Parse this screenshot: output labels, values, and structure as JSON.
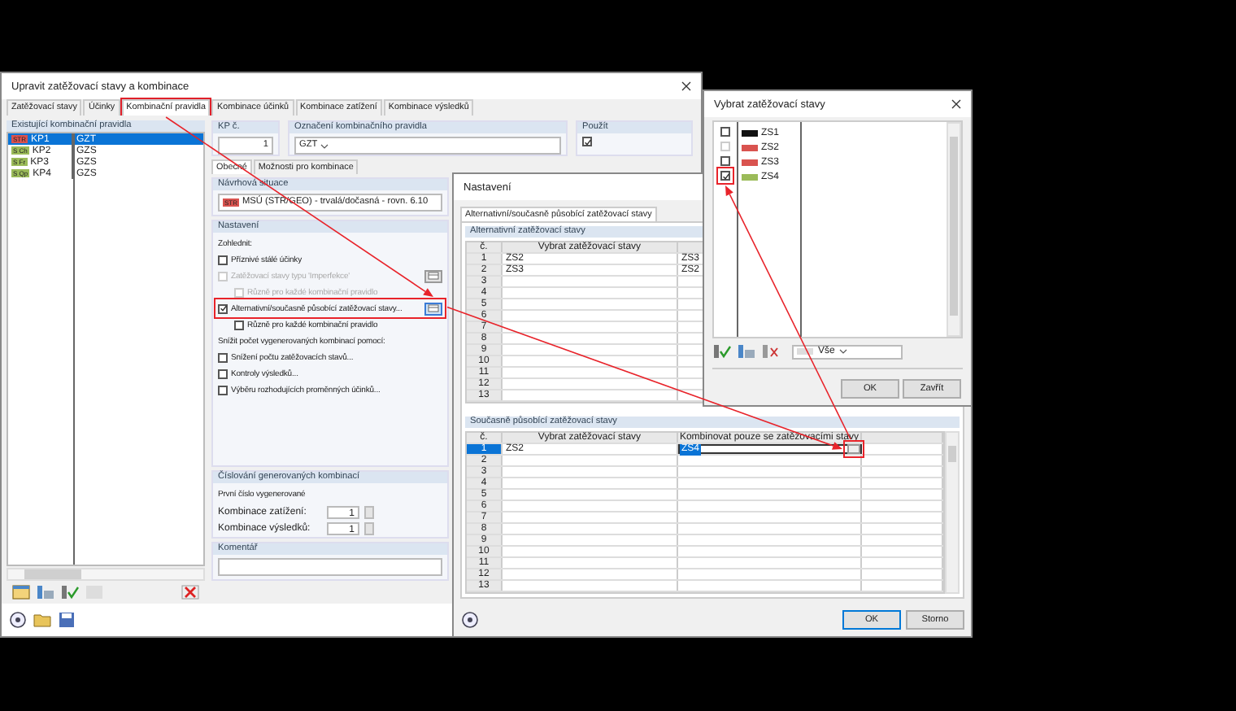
{
  "main_window": {
    "title": "Upravit zatěžovací stavy a kombinace",
    "tabs": [
      {
        "label": "Zatěžovací stavy",
        "selected": false
      },
      {
        "label": "Účinky",
        "selected": false
      },
      {
        "label": "Kombinační pravidla",
        "selected": true
      },
      {
        "label": "Kombinace účinků",
        "selected": false
      },
      {
        "label": "Kombinace zatížení",
        "selected": false
      },
      {
        "label": "Kombinace výsledků",
        "selected": false
      }
    ],
    "rules_list": {
      "header": "Existující kombinační pravidla",
      "rows": [
        {
          "tag": "STR",
          "color": "#d9534f",
          "id": "KP1",
          "value": "GZT",
          "selected": true
        },
        {
          "tag": "S Ch",
          "color": "#9bbb59",
          "id": "KP2",
          "value": "GZS",
          "selected": false
        },
        {
          "tag": "S Fr",
          "color": "#9bbb59",
          "id": "KP3",
          "value": "GZS",
          "selected": false
        },
        {
          "tag": "S Qp",
          "color": "#9bbb59",
          "id": "KP4",
          "value": "GZS",
          "selected": false
        }
      ]
    },
    "rule_number": {
      "label": "KP č.",
      "value": "1"
    },
    "rule_name": {
      "label": "Označení kombinačního pravidla",
      "value": "GZT"
    },
    "use": {
      "label": "Použít",
      "checked": true
    },
    "subtabs": [
      {
        "label": "Obecné",
        "selected": true
      },
      {
        "label": "Možnosti pro kombinace",
        "selected": false
      }
    ],
    "design_situation": {
      "label": "Návrhová situace",
      "tag": "STR",
      "value": "MSÚ (STR/GEO) - trvalá/dočasná - rovn. 6.10"
    },
    "settings": {
      "label": "Nastavení",
      "items": [
        {
          "kind": "label",
          "text": "Zohlednit:"
        },
        {
          "kind": "checkbox",
          "text": "Příznivé stálé účinky",
          "checked": false,
          "disabled": false,
          "button": false
        },
        {
          "kind": "checkbox",
          "text": "Zatěžovací stavy typu 'Imperfekce'",
          "checked": false,
          "disabled": true,
          "button": true,
          "children": [
            {
              "kind": "checkbox",
              "text": "Různě pro každé kombinační pravidlo",
              "checked": false,
              "disabled": true,
              "button": false
            }
          ]
        },
        {
          "kind": "checkbox",
          "text": "Alternativní/současně působící zatěžovací stavy...",
          "checked": true,
          "disabled": false,
          "button": true,
          "children": [
            {
              "kind": "checkbox",
              "text": "Různě pro každé kombinační pravidlo",
              "checked": false,
              "disabled": false,
              "button": false
            }
          ]
        },
        {
          "kind": "label",
          "text": "Snížit počet vygenerovaných kombinací pomocí:"
        },
        {
          "kind": "checkbox",
          "text": "Snížení počtu zatěžovacích stavů...",
          "checked": false,
          "disabled": false,
          "button": false
        },
        {
          "kind": "checkbox",
          "text": "Kontroly výsledků...",
          "checked": false,
          "disabled": false,
          "button": false
        },
        {
          "kind": "checkbox",
          "text": "Výběru rozhodujících proměnných účinků...",
          "checked": false,
          "disabled": false,
          "button": false
        }
      ]
    },
    "numbering": {
      "label": "Číslování generovaných kombinací",
      "note": "První číslo vygenerované",
      "fields": [
        {
          "label": "Kombinace zatížení:",
          "value": "1"
        },
        {
          "label": "Kombinace výsledků:",
          "value": "1"
        }
      ]
    },
    "comment": {
      "label": "Komentář"
    }
  },
  "settings_window": {
    "title": "Nastavení",
    "tab": "Alternativní/současně působící zatěžovací stavy",
    "alternative": {
      "label": "Alternativní zatěžovací stavy",
      "columns": [
        "č.",
        "Vybrat zatěžovací stavy"
      ],
      "rows": [
        {
          "cells": [
            "1",
            "ZS2",
            "ZS3"
          ]
        },
        {
          "cells": [
            "2",
            "ZS3",
            "ZS2"
          ]
        },
        {
          "cells": [
            "3"
          ]
        },
        {
          "cells": [
            "4"
          ]
        },
        {
          "cells": [
            "5"
          ]
        },
        {
          "cells": [
            "6"
          ]
        },
        {
          "cells": [
            "7"
          ]
        },
        {
          "cells": [
            "8"
          ]
        },
        {
          "cells": [
            "9"
          ]
        },
        {
          "cells": [
            "10"
          ]
        },
        {
          "cells": [
            "11"
          ]
        },
        {
          "cells": [
            "12"
          ]
        },
        {
          "cells": [
            "13"
          ]
        }
      ]
    },
    "simultaneous": {
      "label": "Současně působící zatěžovací stavy",
      "columns": [
        "č.",
        "Vybrat zatěžovací stavy",
        "Kombinovat pouze se zatěžovacími stavy"
      ],
      "rows": [
        {
          "cells": [
            "1",
            "ZS2",
            "ZS4"
          ],
          "selected": true
        },
        {
          "cells": [
            "2"
          ],
          "selected": false
        },
        {
          "cells": [
            "3"
          ],
          "selected": false
        },
        {
          "cells": [
            "4"
          ],
          "selected": false
        },
        {
          "cells": [
            "5"
          ],
          "selected": false
        },
        {
          "cells": [
            "6"
          ],
          "selected": false
        },
        {
          "cells": [
            "7"
          ],
          "selected": false
        },
        {
          "cells": [
            "8"
          ],
          "selected": false
        },
        {
          "cells": [
            "9"
          ],
          "selected": false
        },
        {
          "cells": [
            "10"
          ],
          "selected": false
        },
        {
          "cells": [
            "11"
          ],
          "selected": false
        },
        {
          "cells": [
            "12"
          ],
          "selected": false
        },
        {
          "cells": [
            "13"
          ],
          "selected": false
        }
      ]
    },
    "buttons": [
      "OK",
      "Storno"
    ]
  },
  "select_window": {
    "title": "Vybrat zatěžovací stavy",
    "items": [
      {
        "label": "ZS1",
        "color": "#111111",
        "checked": false,
        "disabled": false
      },
      {
        "label": "ZS2",
        "color": "#d9534f",
        "checked": false,
        "disabled": true
      },
      {
        "label": "ZS3",
        "color": "#d9534f",
        "checked": false,
        "disabled": false
      },
      {
        "label": "ZS4",
        "color": "#9bbb59",
        "checked": true,
        "disabled": false
      }
    ],
    "filter": "Vše",
    "buttons": [
      "OK",
      "Zavřít"
    ]
  }
}
